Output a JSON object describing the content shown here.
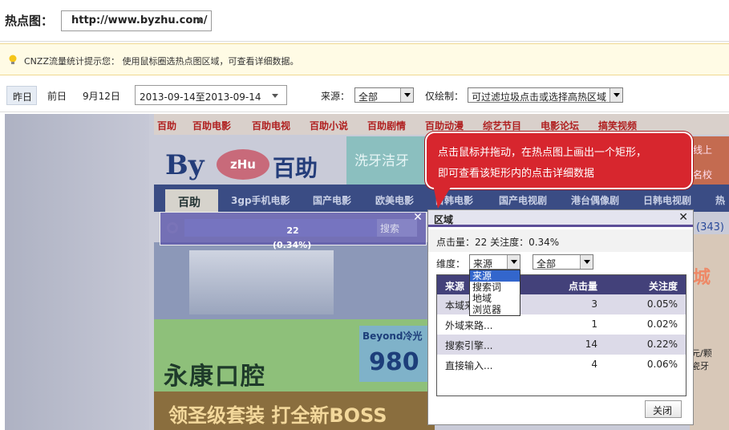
{
  "top": {
    "label": "热点图：",
    "url": "http://www.byzhu.com/"
  },
  "tip": {
    "text": "CNZZ流量统计提示您： 使用鼠标圈选热点图区域，可查看详细数据。"
  },
  "datebar": {
    "yesterday": "昨日",
    "prev_day": "前日",
    "date": "9月12日",
    "range": "2013-09-14至2013-09-14",
    "source_label": "来源：",
    "source_value": "全部",
    "draw_label": "仅绘制：",
    "draw_value": "可过滤垃圾点击或选择高热区域"
  },
  "site": {
    "nav": [
      "百助",
      "百助电影",
      "百助电视",
      "百助小说",
      "百助剧情",
      "百助动漫",
      "综艺节目",
      "电影论坛",
      "搞笑视频"
    ],
    "logo_by": "By",
    "logo_zhu": "zHu",
    "logo_name": "百助",
    "teal_text": "洗牙洁牙",
    "menu_active": "百助",
    "menu": [
      "3gp手机电影",
      "国产电影",
      "欧美电影",
      "日韩电影",
      "国产电视剧",
      "港台偶像剧",
      "日韩电视剧",
      "热"
    ],
    "right_ad": [
      "线上",
      "名校"
    ],
    "count_suffix": "(343)",
    "green_title": "永康口腔",
    "beyond": "Beyond冷光",
    "beyond_num": "980",
    "bottom_text": "领圣级套装  打全新BOSS",
    "right_col": [
      "城",
      "元/颗",
      "瓷牙"
    ]
  },
  "selection": {
    "search_btn": "搜索",
    "clicks": "22",
    "percent": "(0.34%)"
  },
  "bubble": {
    "line1": "点击鼠标并拖动，在热点图上画出一个矩形，",
    "line2": "即可查看该矩形内的点击详细数据"
  },
  "popup": {
    "title": "区域",
    "stats": "点击量：22   关注度：0.34%",
    "dim_label": "维度：",
    "dim_value": "来源",
    "all_value": "全部",
    "dim_options": [
      "来源",
      "搜索词",
      "地域",
      "浏览器"
    ],
    "columns": [
      "来源",
      "点击量",
      "关注度"
    ],
    "rows": [
      {
        "source": "本域来...",
        "clicks": "3",
        "attention": "0.05%"
      },
      {
        "source": "外域来路...",
        "clicks": "1",
        "attention": "0.02%"
      },
      {
        "source": "搜索引擎...",
        "clicks": "14",
        "attention": "0.22%"
      },
      {
        "source": "直接输入...",
        "clicks": "4",
        "attention": "0.06%"
      }
    ],
    "close": "关闭"
  }
}
